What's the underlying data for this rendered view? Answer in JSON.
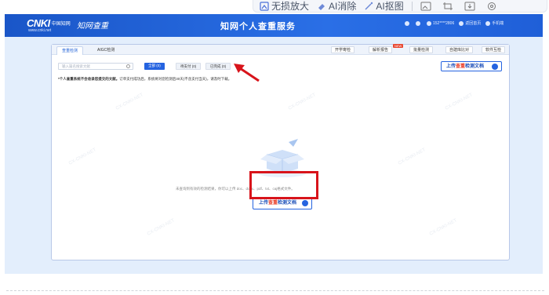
{
  "float_toolbar": {
    "items": [
      {
        "label": "无损放大",
        "icon": "enlarge-icon"
      },
      {
        "label": "AI消除",
        "icon": "eraser-icon"
      },
      {
        "label": "AI抠图",
        "icon": "magic-wand-icon"
      }
    ],
    "icons": [
      "image-icon",
      "crop-icon",
      "download-icon",
      "settings-icon"
    ]
  },
  "header": {
    "logo_text": "CNKI",
    "logo_cn": "中国知网",
    "logo_url": "www.cnki.net",
    "brand": "知网查重",
    "title": "知网个人查重服务",
    "user": "152****2806",
    "links": [
      "返回首页",
      "手机端"
    ]
  },
  "tabs": {
    "main": [
      {
        "label": "查重检测",
        "active": true
      },
      {
        "label": "AIGC检测",
        "active": false
      }
    ],
    "right": [
      {
        "label": "开学寄检"
      },
      {
        "label": "解析报告",
        "badge": "NEW"
      },
      {
        "label": "批量检测"
      },
      {
        "label": "自建库比对"
      },
      {
        "label": "软件互检"
      }
    ]
  },
  "search": {
    "placeholder": "输入篇名搜索文献"
  },
  "filters": [
    {
      "label": "全部 (0)",
      "selected": true
    },
    {
      "label": "待支付 (0)",
      "selected": false
    },
    {
      "label": "已完成 (0)",
      "selected": false
    }
  ],
  "upload_button": {
    "label_a": "上传",
    "label_red": "查重",
    "label_b": "检测文档"
  },
  "notice": {
    "bold": "*个人查重系统不会收录您提交的文献。",
    "rest": "订单支付成功后，系统将对您检测后30天(不含支付当天)，请及时下载。"
  },
  "empty_text": "未查询到有效的检测结果，你可以上传 doc、docx、pdf、txt、caj格式文件。",
  "watermark": "CX-CNKI-NET",
  "colors": {
    "accent": "#2563e0",
    "highlight": "#d8141b",
    "header": "#1f5fd8"
  }
}
